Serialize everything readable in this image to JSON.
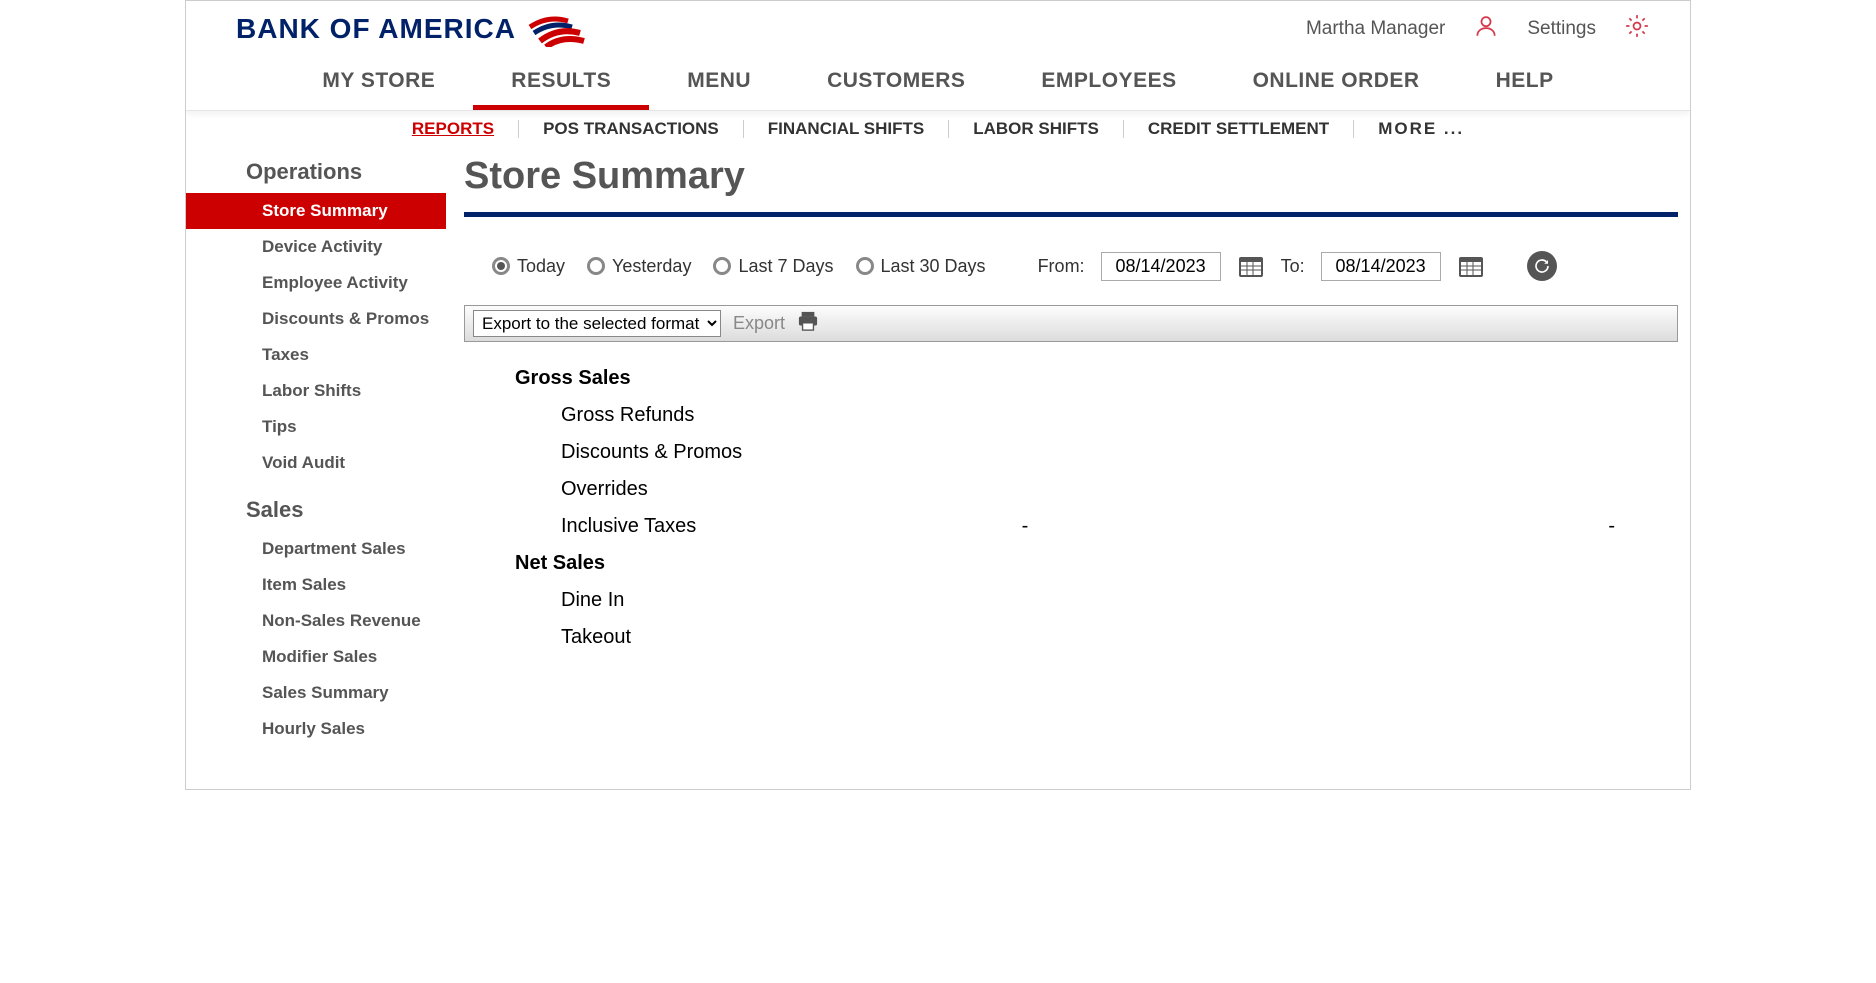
{
  "header": {
    "logo_text": "BANK OF AMERICA",
    "user_name": "Martha Manager",
    "settings_label": "Settings"
  },
  "main_nav": [
    {
      "label": "MY STORE",
      "active": false
    },
    {
      "label": "RESULTS",
      "active": true
    },
    {
      "label": "MENU",
      "active": false
    },
    {
      "label": "CUSTOMERS",
      "active": false
    },
    {
      "label": "EMPLOYEES",
      "active": false
    },
    {
      "label": "ONLINE ORDER",
      "active": false
    },
    {
      "label": "HELP",
      "active": false
    }
  ],
  "sub_nav": [
    {
      "label": "REPORTS",
      "active": true
    },
    {
      "label": "POS TRANSACTIONS",
      "active": false
    },
    {
      "label": "FINANCIAL SHIFTS",
      "active": false
    },
    {
      "label": "LABOR SHIFTS",
      "active": false
    },
    {
      "label": "CREDIT SETTLEMENT",
      "active": false
    }
  ],
  "sub_nav_more": "MORE ...",
  "sidebar": {
    "groups": [
      {
        "title": "Operations",
        "items": [
          {
            "label": "Store Summary",
            "active": true
          },
          {
            "label": "Device Activity"
          },
          {
            "label": "Employee Activity"
          },
          {
            "label": "Discounts & Promos"
          },
          {
            "label": "Taxes"
          },
          {
            "label": "Labor Shifts"
          },
          {
            "label": "Tips"
          },
          {
            "label": "Void Audit"
          }
        ]
      },
      {
        "title": "Sales",
        "items": [
          {
            "label": "Department Sales"
          },
          {
            "label": "Item Sales"
          },
          {
            "label": "Non-Sales Revenue"
          },
          {
            "label": "Modifier Sales"
          },
          {
            "label": "Sales Summary"
          },
          {
            "label": "Hourly Sales"
          }
        ]
      }
    ]
  },
  "page": {
    "title": "Store Summary"
  },
  "filters": {
    "options": [
      {
        "label": "Today",
        "checked": true
      },
      {
        "label": "Yesterday",
        "checked": false
      },
      {
        "label": "Last 7 Days",
        "checked": false
      },
      {
        "label": "Last 30 Days",
        "checked": false
      }
    ],
    "from_label": "From:",
    "from_value": "08/14/2023",
    "to_label": "To:",
    "to_value": "08/14/2023"
  },
  "toolbar": {
    "export_select": "Export to the selected format",
    "export_link": "Export"
  },
  "report": {
    "rows": [
      {
        "type": "section",
        "label": "Gross Sales",
        "v1": "",
        "v2": ""
      },
      {
        "type": "sub",
        "label": "Gross Refunds",
        "v1": "",
        "v2": ""
      },
      {
        "type": "sub",
        "label": "Discounts & Promos",
        "v1": "",
        "v2": ""
      },
      {
        "type": "sub",
        "label": "Overrides",
        "v1": "",
        "v2": ""
      },
      {
        "type": "sub",
        "label": "Inclusive Taxes",
        "v1": "-",
        "v2": "-"
      },
      {
        "type": "section",
        "label": "Net Sales",
        "v1": "",
        "v2": ""
      },
      {
        "type": "sub",
        "label": "Dine In",
        "v1": "",
        "v2": ""
      },
      {
        "type": "sub",
        "label": "Takeout",
        "v1": "",
        "v2": ""
      }
    ]
  }
}
